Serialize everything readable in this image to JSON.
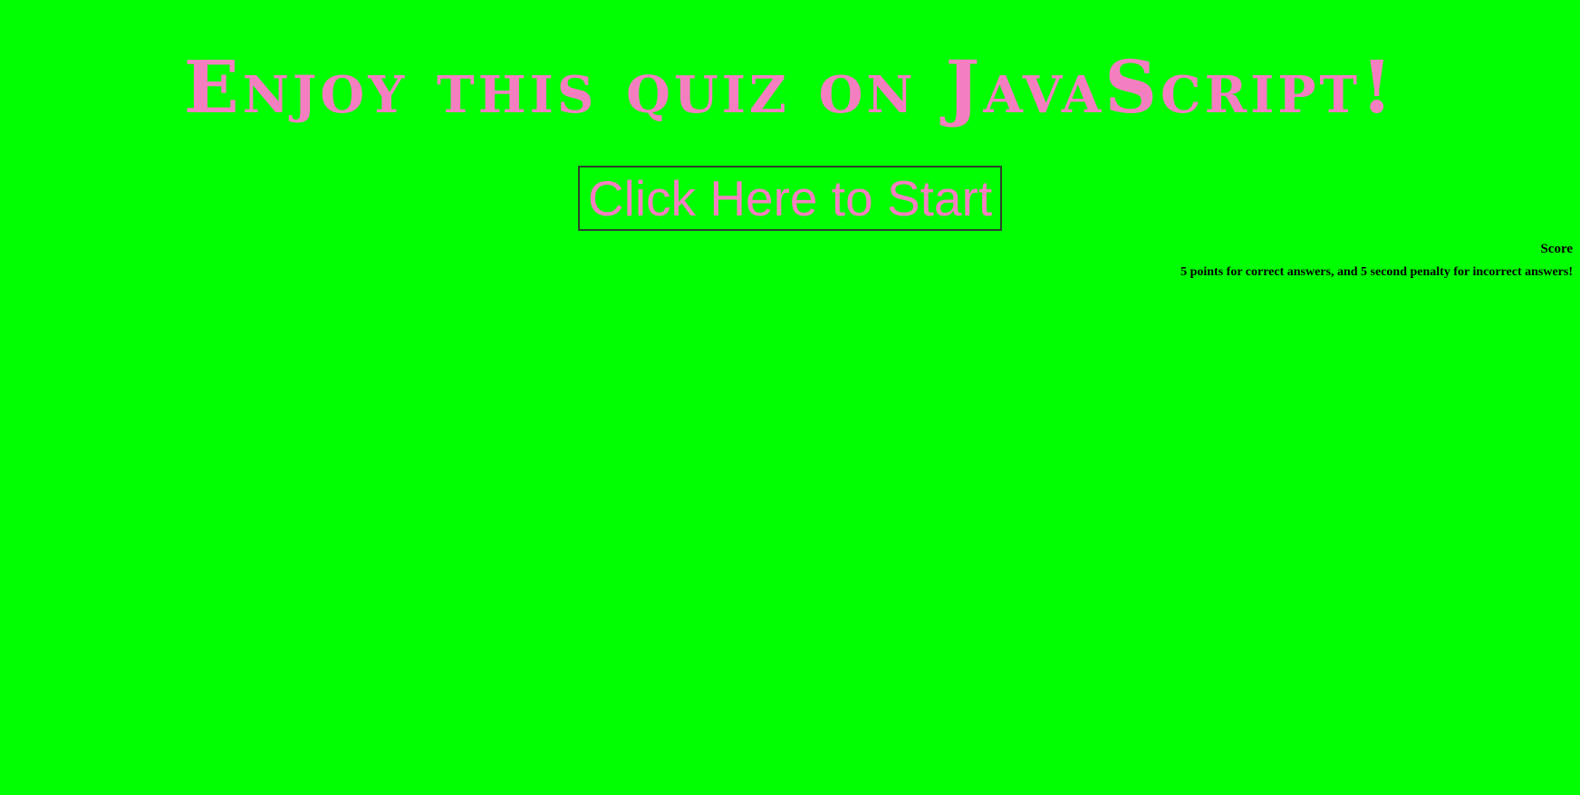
{
  "page": {
    "background_color": "#00ff00",
    "accent_color": "#f47fc0"
  },
  "header": {
    "title": "Enjoy this quiz on JavaScript!"
  },
  "controls": {
    "start_label": "Click Here to Start"
  },
  "score": {
    "label": "Score",
    "rules": "5 points for correct answers, and 5 second penalty for incorrect answers!"
  }
}
